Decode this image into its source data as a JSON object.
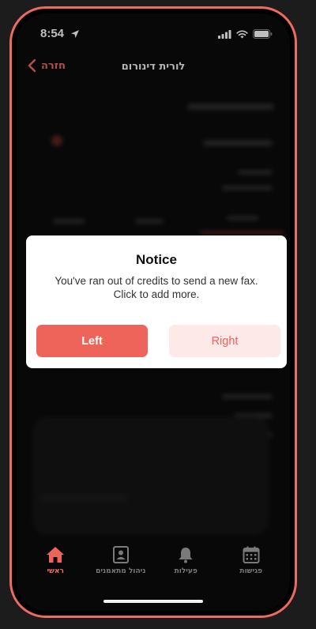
{
  "status_bar": {
    "time": "8:54"
  },
  "header": {
    "back_label": "חזרה",
    "title": "לורית דינורום"
  },
  "modal": {
    "title": "Notice",
    "message": "You've ran out of credits to send a new fax. Click to add more.",
    "left_button": "Left",
    "right_button": "Right"
  },
  "tab_bar": {
    "tabs": [
      {
        "label": "ראשי",
        "icon": "home-icon",
        "active": true
      },
      {
        "label": "ניהול מתאמנים",
        "icon": "contacts-icon",
        "active": false
      },
      {
        "label": "פעילות",
        "icon": "bell-icon",
        "active": false
      },
      {
        "label": "פגישות",
        "icon": "calendar-icon",
        "active": false
      }
    ]
  },
  "colors": {
    "accent": "#ee635a",
    "accent_light": "#fde9e8",
    "frame": "#ee6b62",
    "background": "#0b0b0b",
    "inactive_tab": "#7a7a7a"
  }
}
